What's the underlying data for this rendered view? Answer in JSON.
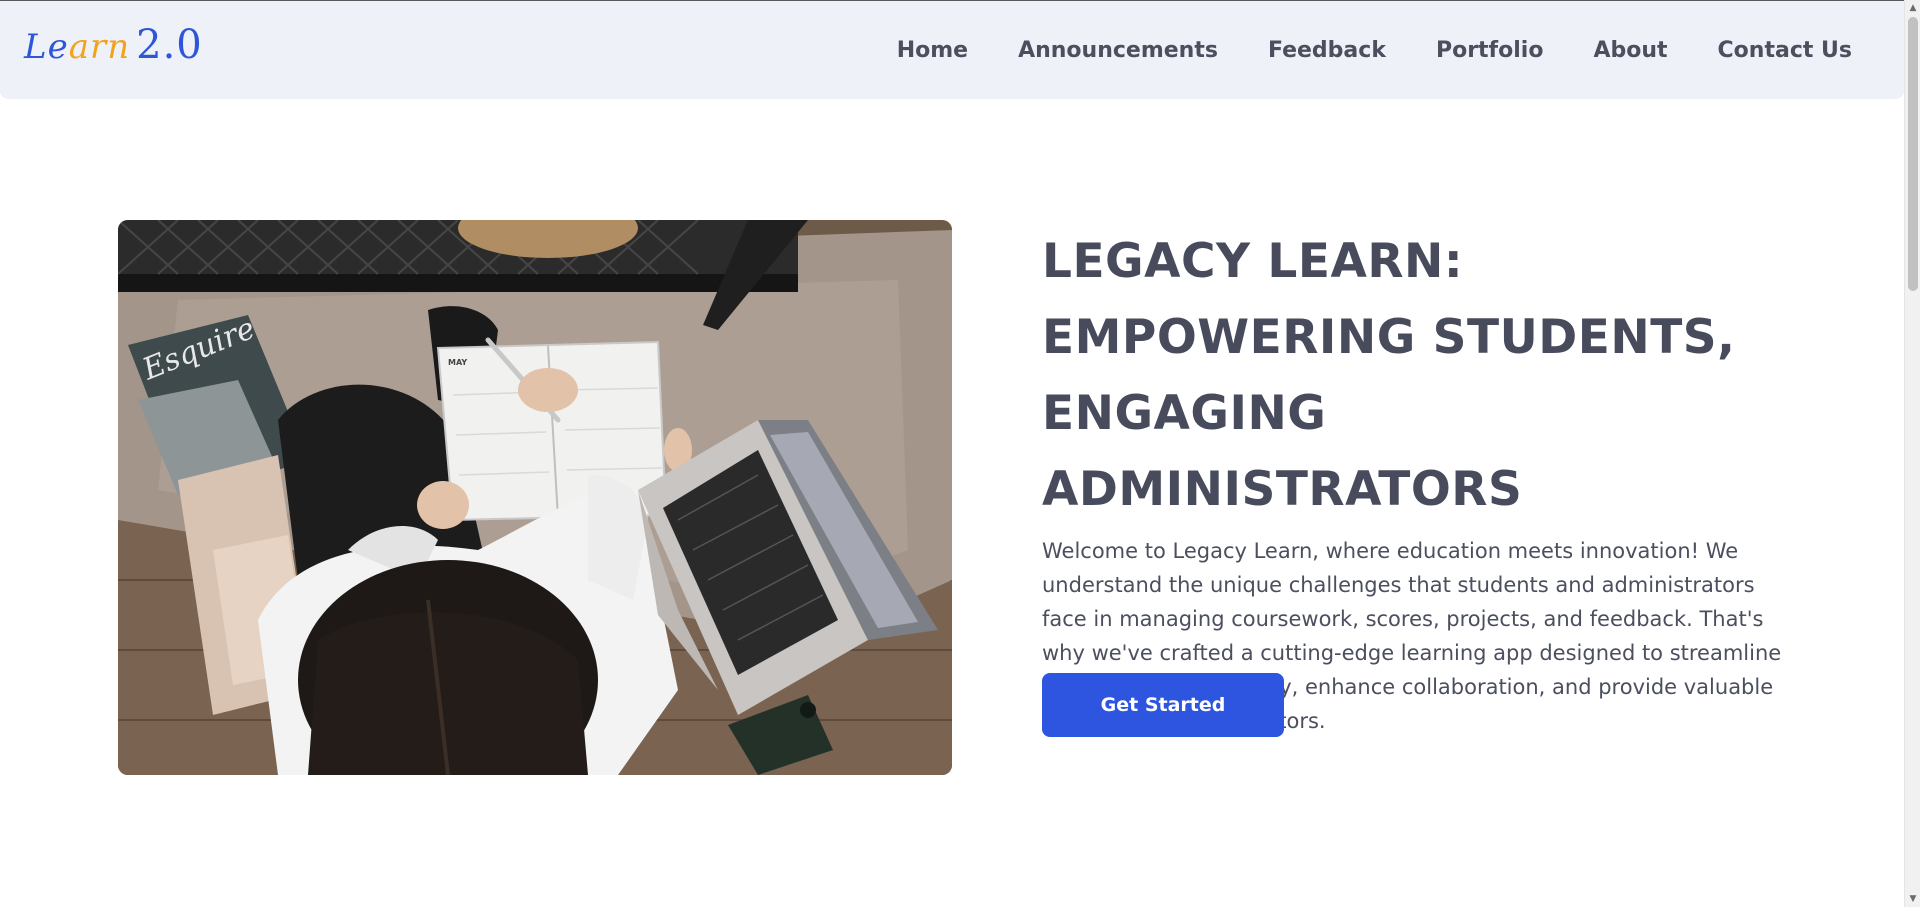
{
  "brand": {
    "logo_main": "Le",
    "logo_accent": "arn",
    "logo_version": "2.0",
    "colors": {
      "primary": "#2f56d9",
      "accent": "#f3a21b",
      "header_bg": "#eef1f8",
      "text": "#474b5c",
      "button": "#2d55e0"
    }
  },
  "nav": {
    "items": [
      {
        "label": "Home"
      },
      {
        "label": "Announcements"
      },
      {
        "label": "Feedback"
      },
      {
        "label": "Portfolio"
      },
      {
        "label": "About"
      },
      {
        "label": "Contact Us"
      }
    ]
  },
  "hero": {
    "title": "LEGACY LEARN: EMPOWERING STUDENTS, ENGAGING ADMINISTRATORS",
    "description": "Welcome to Legacy Learn, where education meets innovation! We understand the unique challenges that students and administrators face in managing coursework, scores, projects, and feedback. That's why we've crafted a cutting-edge learning app designed to streamline the educational journey, enhance collaboration, and provide valuable insights for administrators.",
    "cta_label": "Get Started",
    "image": {
      "icon": "study-photo",
      "magazine_text": "Esquire",
      "planner_text": "MAY"
    }
  },
  "scrollbar": {
    "up_icon": "▲",
    "down_icon": "▼"
  }
}
